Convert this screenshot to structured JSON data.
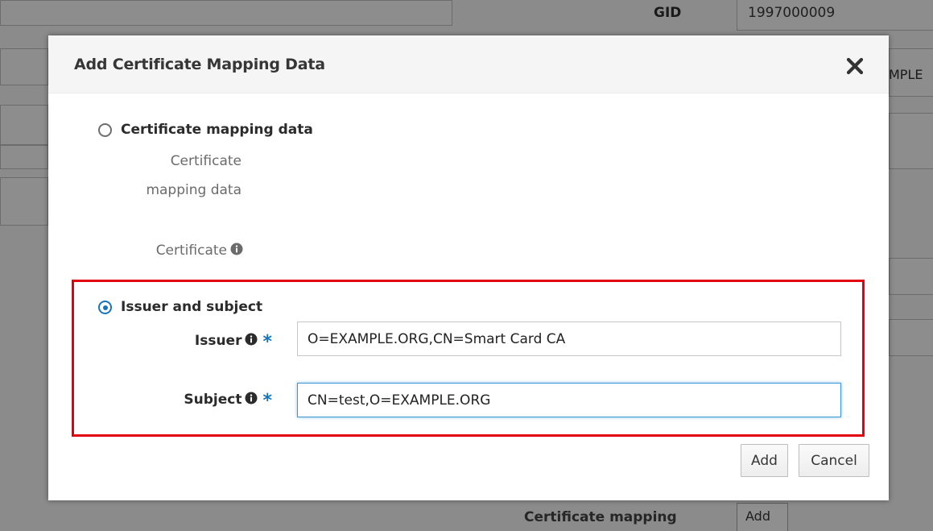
{
  "background": {
    "gid_label": "GID",
    "gid_value": "1997000009",
    "partial_value": "MPLE",
    "cert_mapping_label": "Certificate mapping",
    "cert_mapping_add": "Add"
  },
  "dialog": {
    "title": "Add Certificate Mapping Data",
    "close_icon": "close-icon",
    "option_mapping_data": {
      "label": "Certificate mapping data",
      "selected": false,
      "field_label_line1": "Certificate",
      "field_label_line2": "mapping data",
      "certificate_label": "Certificate"
    },
    "option_issuer_subject": {
      "label": "Issuer and subject",
      "selected": true,
      "issuer_label": "Issuer",
      "issuer_value": "O=EXAMPLE.ORG,CN=Smart Card CA",
      "subject_label": "Subject",
      "subject_value": "CN=test,O=EXAMPLE.ORG",
      "required_marker": "*"
    },
    "buttons": {
      "add": "Add",
      "cancel": "Cancel"
    }
  },
  "colors": {
    "accent": "#1c73b4",
    "highlight": "#e0000f",
    "overlay": "#8b8b8b"
  }
}
